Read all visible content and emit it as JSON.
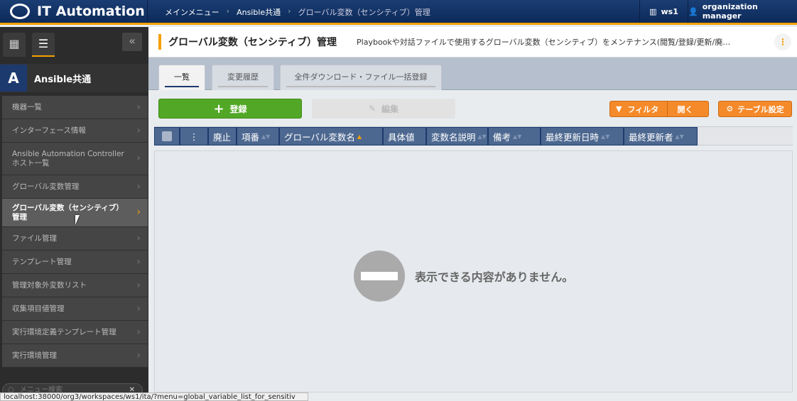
{
  "header": {
    "app_title": "IT Automation",
    "breadcrumb": [
      "メインメニュー",
      "Ansible共通",
      "グローバル変数（センシティブ）管理"
    ],
    "workspace": "ws1",
    "user": "organization manager"
  },
  "sidebar": {
    "group_title": "Ansible共通",
    "items": [
      {
        "label": "機器一覧"
      },
      {
        "label": "インターフェース情報"
      },
      {
        "label": "Ansible Automation Controller ホスト一覧"
      },
      {
        "label": "グローバル変数管理"
      },
      {
        "label": "グローバル変数（センシティブ）管理",
        "active": true
      },
      {
        "label": "ファイル管理"
      },
      {
        "label": "テンプレート管理"
      },
      {
        "label": "管理対象外変数リスト"
      },
      {
        "label": "収集項目値管理"
      },
      {
        "label": "実行環境定義テンプレート管理"
      },
      {
        "label": "実行環境管理"
      }
    ],
    "search_placeholder": "メニュー検索"
  },
  "page": {
    "title": "グローバル変数（センシティブ）管理",
    "description": "Playbookや対話ファイルで使用するグローバル変数（センシティブ）をメンテナンス(閲覧/登録/更新/廃…"
  },
  "tabs": [
    {
      "label": "一覧",
      "active": true
    },
    {
      "label": "変更履歴"
    },
    {
      "label": "全件ダウンロード・ファイル一括登録"
    }
  ],
  "toolbar": {
    "register": "登録",
    "edit": "編集",
    "filter": "フィルタ",
    "filter_open": "開く",
    "table_settings": "テーブル設定"
  },
  "table": {
    "columns": [
      "廃止",
      "項番",
      "グローバル変数名",
      "具体値",
      "変数名説明",
      "備考",
      "最終更新日時",
      "最終更新者"
    ],
    "sorted_column": "グローバル変数名",
    "empty_message": "表示できる内容がありません。"
  },
  "status_bar": "localhost:38000/org3/workspaces/ws1/ita/?menu=global_variable_list_for_sensitiv",
  "colors": {
    "header": "#0d2a5a",
    "accent": "#f5a000",
    "register": "#52a826",
    "orange_button": "#f58a2a",
    "table_header": "#4d6890"
  }
}
